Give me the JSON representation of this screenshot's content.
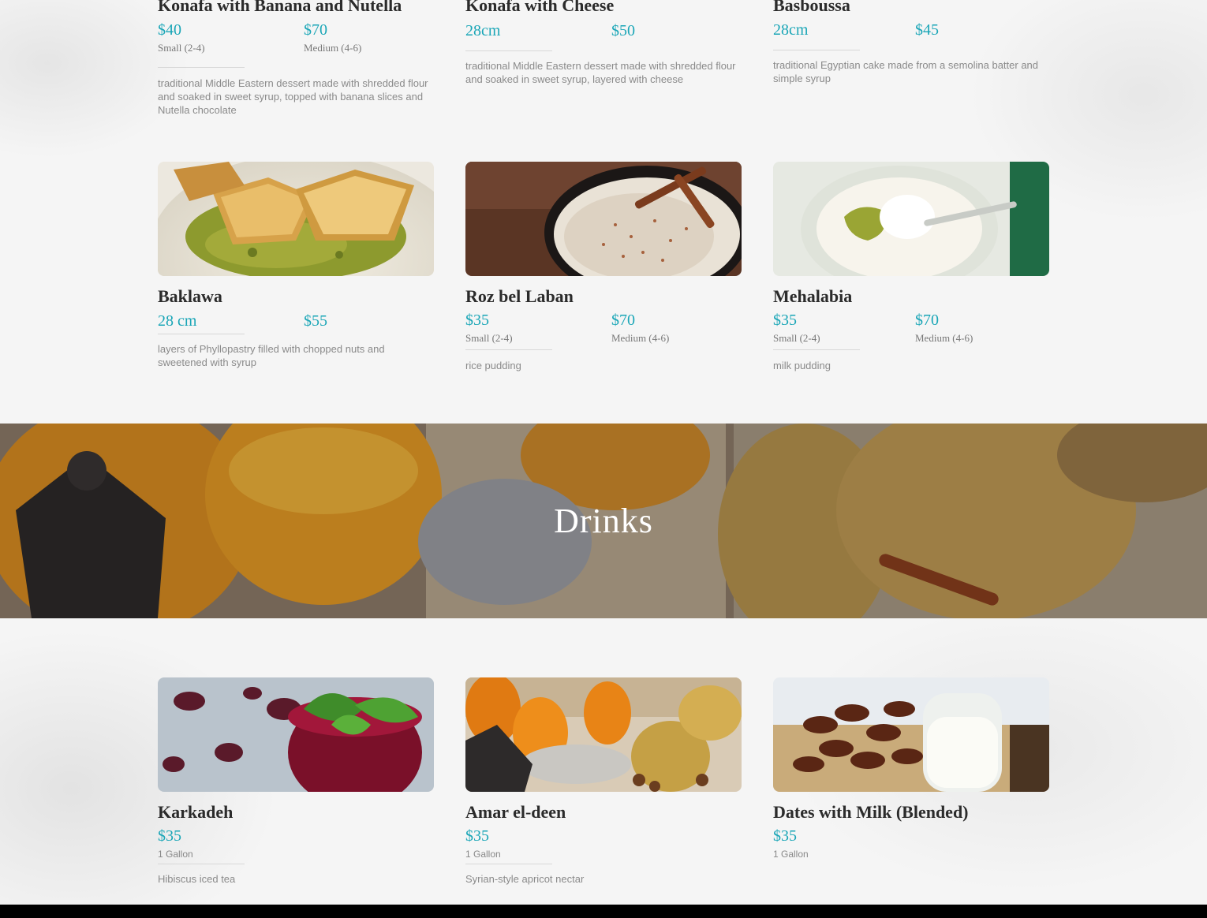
{
  "sweets_row1": [
    {
      "title": "Konafa with Banana and Nutella",
      "prices": [
        {
          "price": "$40",
          "size": "Small (2-4)"
        },
        {
          "price": "$70",
          "size": "Medium (4-6)"
        }
      ],
      "description": "traditional Middle Eastern dessert made with shredded flour and soaked in sweet syrup, topped with banana slices and Nutella chocolate"
    },
    {
      "title": "Konafa with Cheese",
      "prices": [
        {
          "price": "28cm",
          "size": ""
        },
        {
          "price": "$50",
          "size": ""
        }
      ],
      "description": "traditional Middle Eastern dessert made with shredded flour and soaked in sweet syrup, layered with cheese"
    },
    {
      "title": "Basboussa",
      "prices": [
        {
          "price": "28cm",
          "size": ""
        },
        {
          "price": "$45",
          "size": ""
        }
      ],
      "description": "traditional Egyptian cake made from a semolina batter and simple syrup"
    }
  ],
  "sweets_row2": [
    {
      "title": "Baklawa",
      "prices": [
        {
          "price": "28 cm",
          "size": ""
        },
        {
          "price": "$55",
          "size": ""
        }
      ],
      "description": "layers of Phyllopastry filled with chopped nuts and sweetened with syrup",
      "image": "baklava-photo"
    },
    {
      "title": "Roz bel Laban",
      "prices": [
        {
          "price": "$35",
          "size": "Small (2-4)"
        },
        {
          "price": "$70",
          "size": "Medium (4-6)"
        }
      ],
      "description": "rice pudding",
      "image": "rice-pudding-photo"
    },
    {
      "title": "Mehalabia",
      "prices": [
        {
          "price": "$35",
          "size": "Small (2-4)"
        },
        {
          "price": "$70",
          "size": "Medium (4-6)"
        }
      ],
      "description": "milk pudding",
      "image": "milk-pudding-photo"
    }
  ],
  "drinks_banner": {
    "title": "Drinks"
  },
  "drinks": [
    {
      "title": "Karkadeh",
      "price": "$35",
      "size": "1 Gallon",
      "description": "Hibiscus iced tea",
      "image": "hibiscus-tea-photo"
    },
    {
      "title": "Amar el-deen",
      "price": "$35",
      "size": "1 Gallon",
      "description": "Syrian-style apricot nectar",
      "image": "apricot-nectar-photo"
    },
    {
      "title": "Dates with Milk (Blended)",
      "price": "$35",
      "size": "1 Gallon",
      "description": "",
      "image": "dates-milk-photo"
    }
  ],
  "colors": {
    "price": "#1aa6b7",
    "title": "#2b2b2b",
    "text": "#8a8a8a",
    "background": "#f5f5f5"
  }
}
